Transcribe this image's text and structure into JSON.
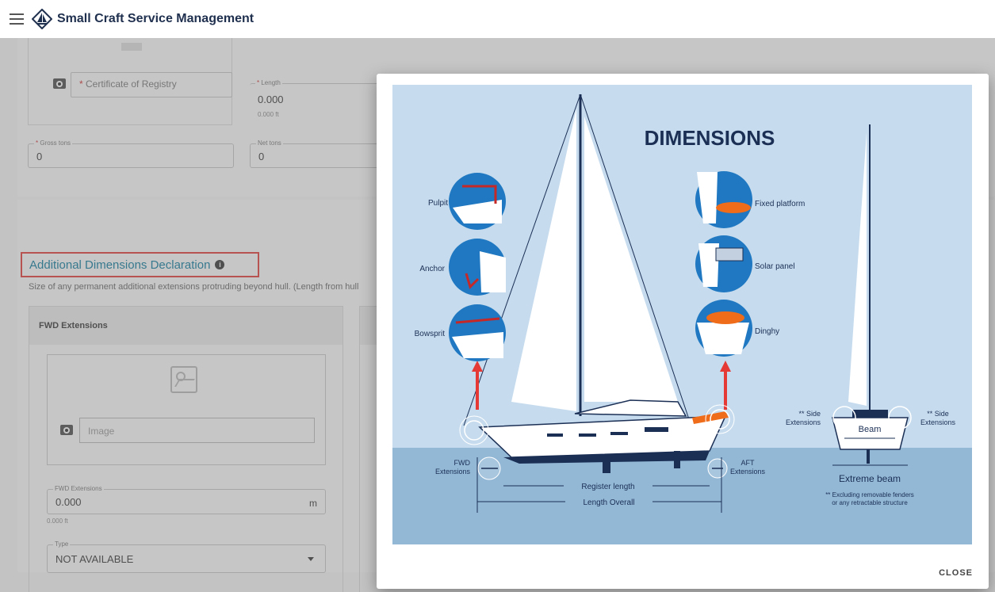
{
  "app": {
    "title": "Small Craft Service Management"
  },
  "vessel": {
    "registry_placeholder": "Certificate of Registry",
    "length_label": "Length",
    "length_value": "0.000",
    "length_hint": "0.000 ft",
    "gross_label": "Gross tons",
    "gross_value": "0",
    "net_label": "Net tons",
    "net_value": "0"
  },
  "additional": {
    "title": "Additional Dimensions Declaration",
    "description": "Size of any permanent additional extensions protruding beyond hull. (Length from hull",
    "fwd_panel_title": "FWD Extensions",
    "image_placeholder": "Image",
    "fwd_label": "FWD Extensions",
    "fwd_value": "0.000",
    "fwd_unit": "m",
    "fwd_hint": "0.000 ft",
    "type_label": "Type",
    "type_value": "NOT AVAILABLE"
  },
  "modal": {
    "close_label": "CLOSE",
    "figure": {
      "heading": "DIMENSIONS",
      "items": {
        "pulpit": "Pulpit",
        "anchor": "Anchor",
        "bowsprit": "Bowsprit",
        "fixed_platform": "Fixed platform",
        "solar_panel": "Solar panel",
        "dinghy": "Dinghy"
      },
      "fwd_ext_line1": "FWD",
      "fwd_ext_line2": "Extensions",
      "aft_ext_line1": "AFT",
      "aft_ext_line2": "Extensions",
      "register_length": "Register length",
      "length_overall": "Length Overall",
      "side_ext_line1": "** Side",
      "side_ext_line2": "Extensions",
      "beam": "Beam",
      "extreme_beam": "Extreme beam",
      "footnote_line1": "** Excluding removable fenders",
      "footnote_line2": "or any retractable structure"
    }
  },
  "colors": {
    "navy": "#1b2f55",
    "sky": "#bfd6ea",
    "sea": "#8fb4d3",
    "accent_red": "#e53935",
    "teal_title": "#0a7a9f",
    "circle_blue": "#1f78c1"
  }
}
